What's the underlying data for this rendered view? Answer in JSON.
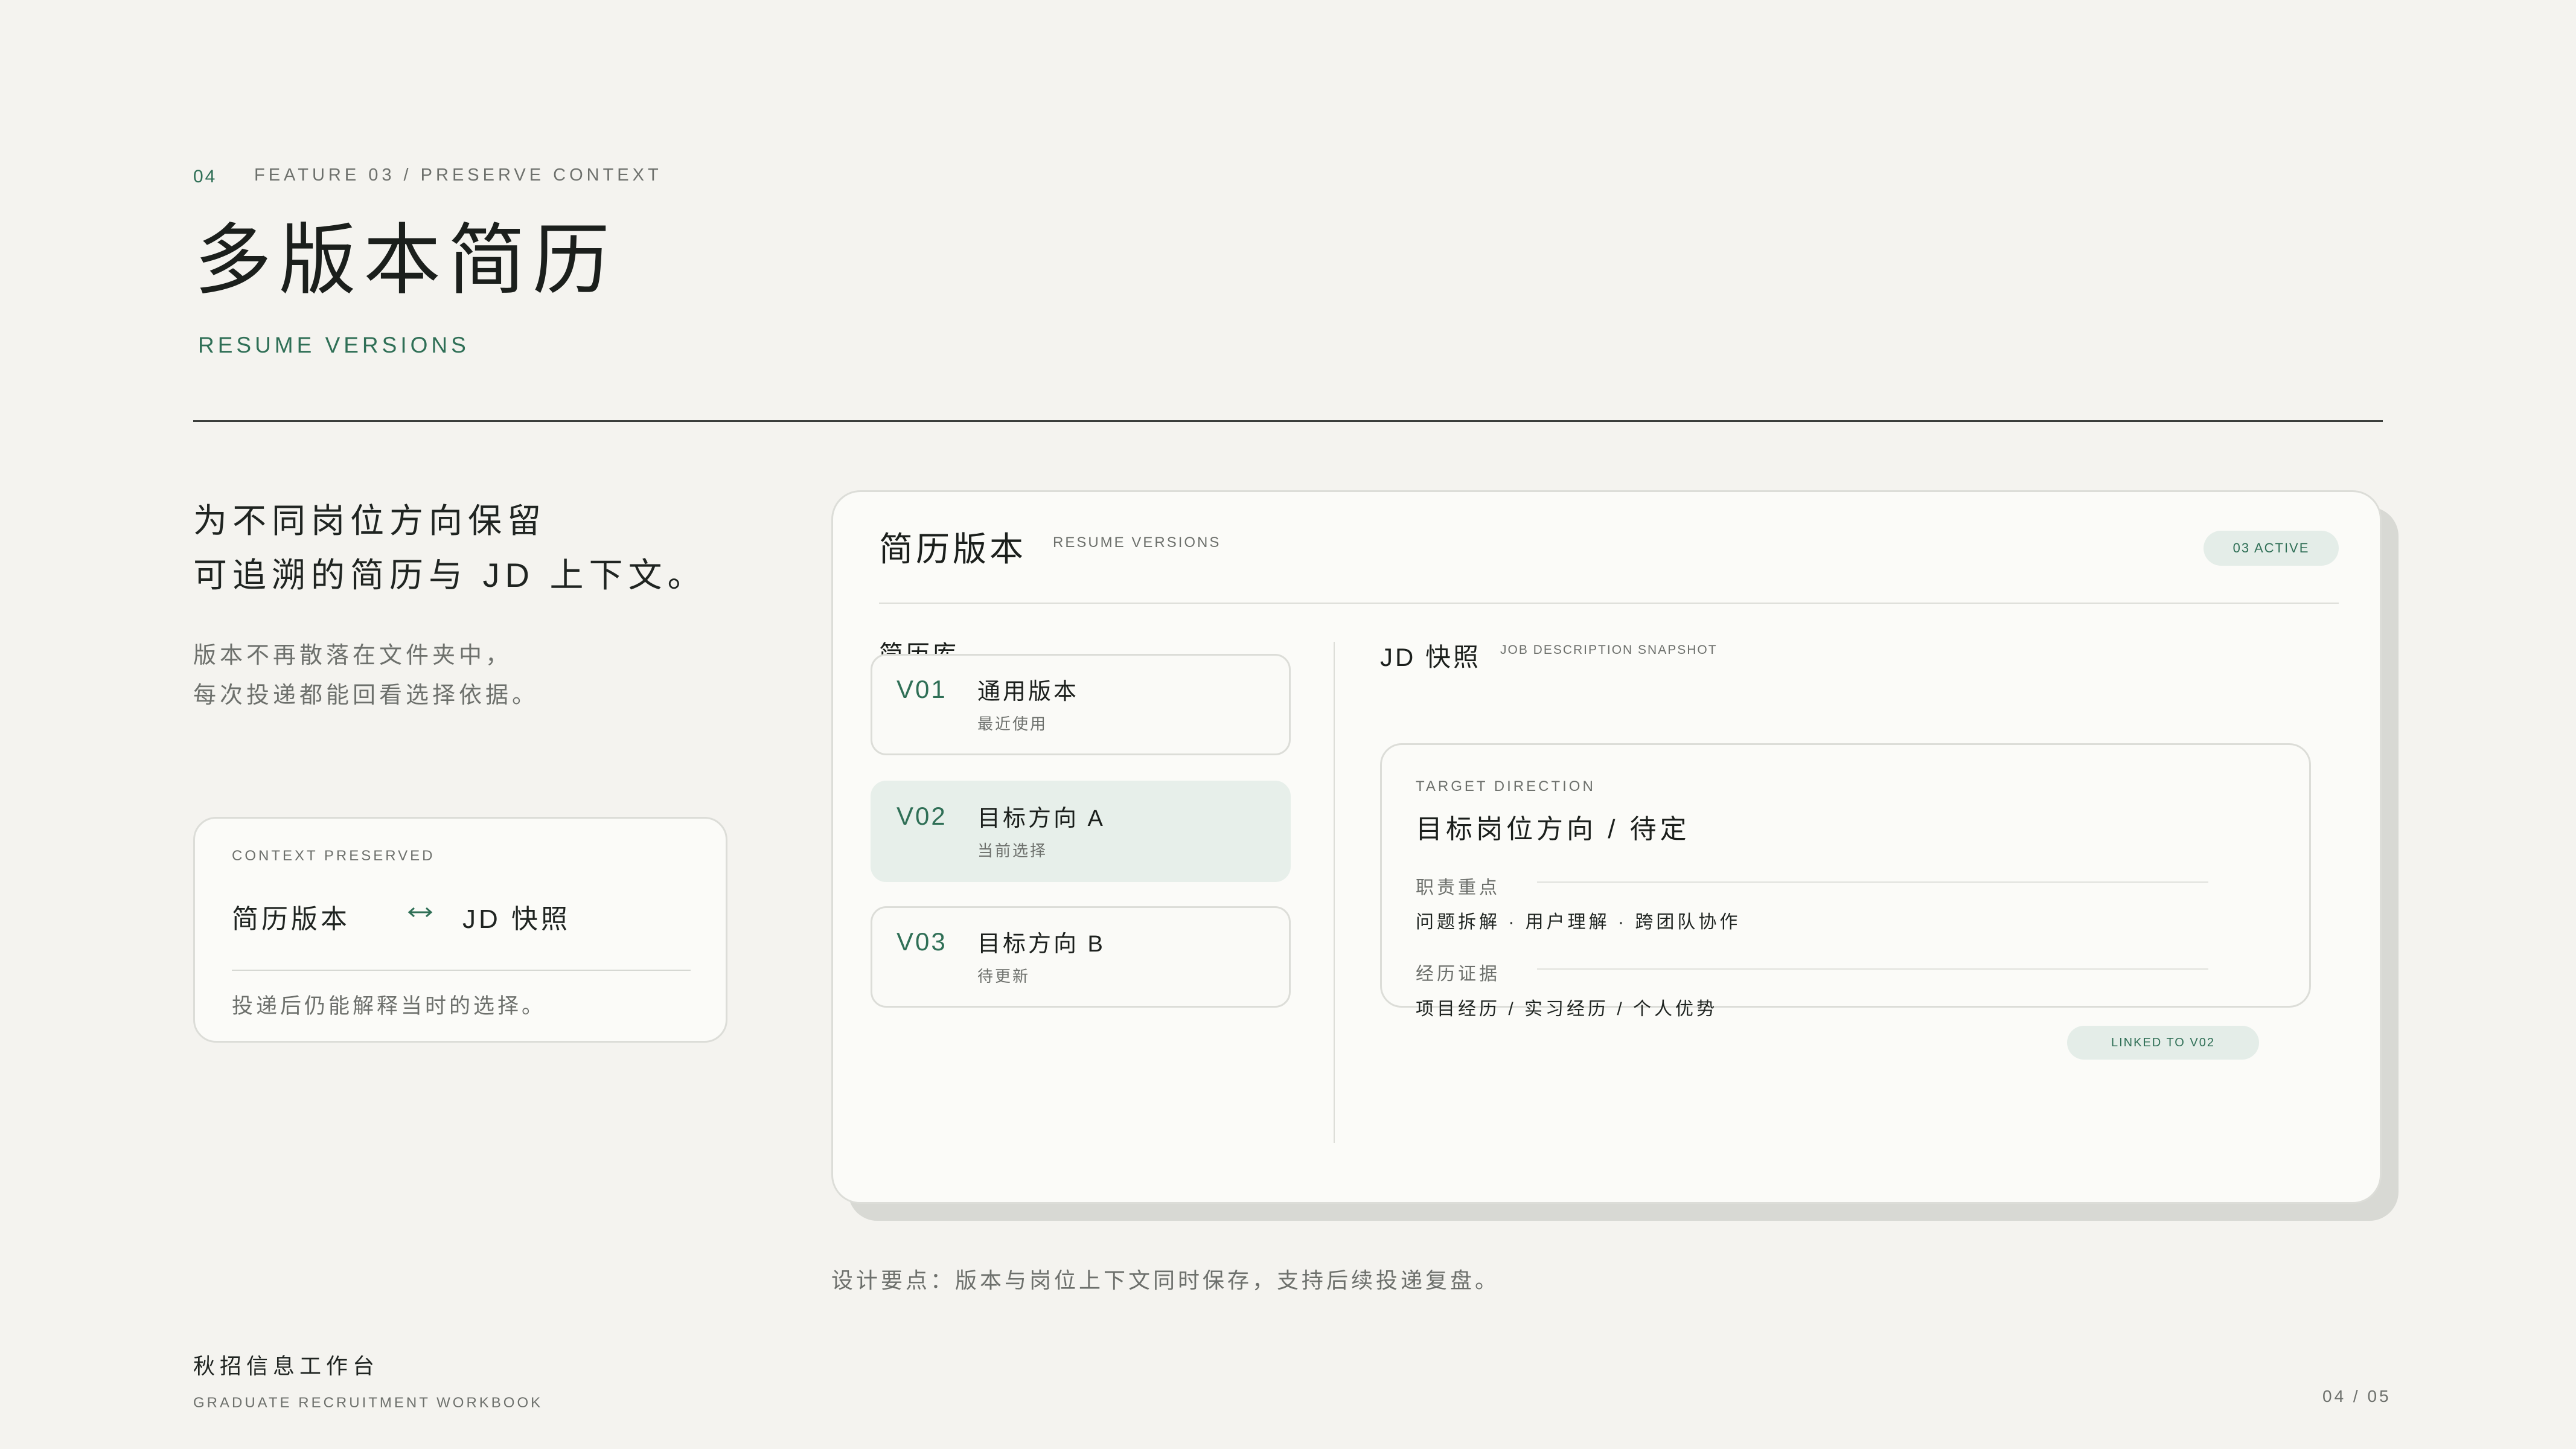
{
  "header": {
    "slide_number": "04",
    "feature": "FEATURE 03 / PRESERVE CONTEXT",
    "title": "多版本简历",
    "subtitle": "RESUME VERSIONS"
  },
  "intro": {
    "lead_line1": "为不同岗位方向保留",
    "lead_line2": "可追溯的简历与 JD 上下文。",
    "desc_line1": "版本不再散落在文件夹中，",
    "desc_line2": "每次投递都能回看选择依据。"
  },
  "context_card": {
    "label": "CONTEXT PRESERVED",
    "left": "简历版本",
    "arrow_icon": "bidirectional-arrow-icon",
    "right": "JD 快照",
    "note": "投递后仍能解释当时的选择。"
  },
  "panel": {
    "title": "简历版本",
    "subtitle": "RESUME VERSIONS",
    "badge": "03 ACTIVE",
    "library_label": "简历库",
    "versions": [
      {
        "code": "V01",
        "name": "通用版本",
        "state": "最近使用"
      },
      {
        "code": "V02",
        "name": "目标方向 A",
        "state": "当前选择"
      },
      {
        "code": "V03",
        "name": "目标方向 B",
        "state": "待更新"
      }
    ],
    "jd": {
      "title": "JD 快照",
      "subtitle": "JOB DESCRIPTION SNAPSHOT",
      "target_label": "TARGET DIRECTION",
      "target": "目标岗位方向 / 待定",
      "duty_label": "职责重点",
      "duty_value": "问题拆解 · 用户理解 · 跨团队协作",
      "evidence_label": "经历证据",
      "evidence_value": "项目经历 / 实习经历 / 个人优势",
      "linked": "LINKED TO V02"
    }
  },
  "design_note": "设计要点：版本与岗位上下文同时保存，支持后续投递复盘。",
  "footer": {
    "title": "秋招信息工作台",
    "subtitle": "GRADUATE RECRUITMENT WORKBOOK",
    "pager": "04 / 05"
  },
  "colors": {
    "background": "#f4f3ef",
    "accent": "#2f6f56",
    "active_card": "#e7efea"
  }
}
